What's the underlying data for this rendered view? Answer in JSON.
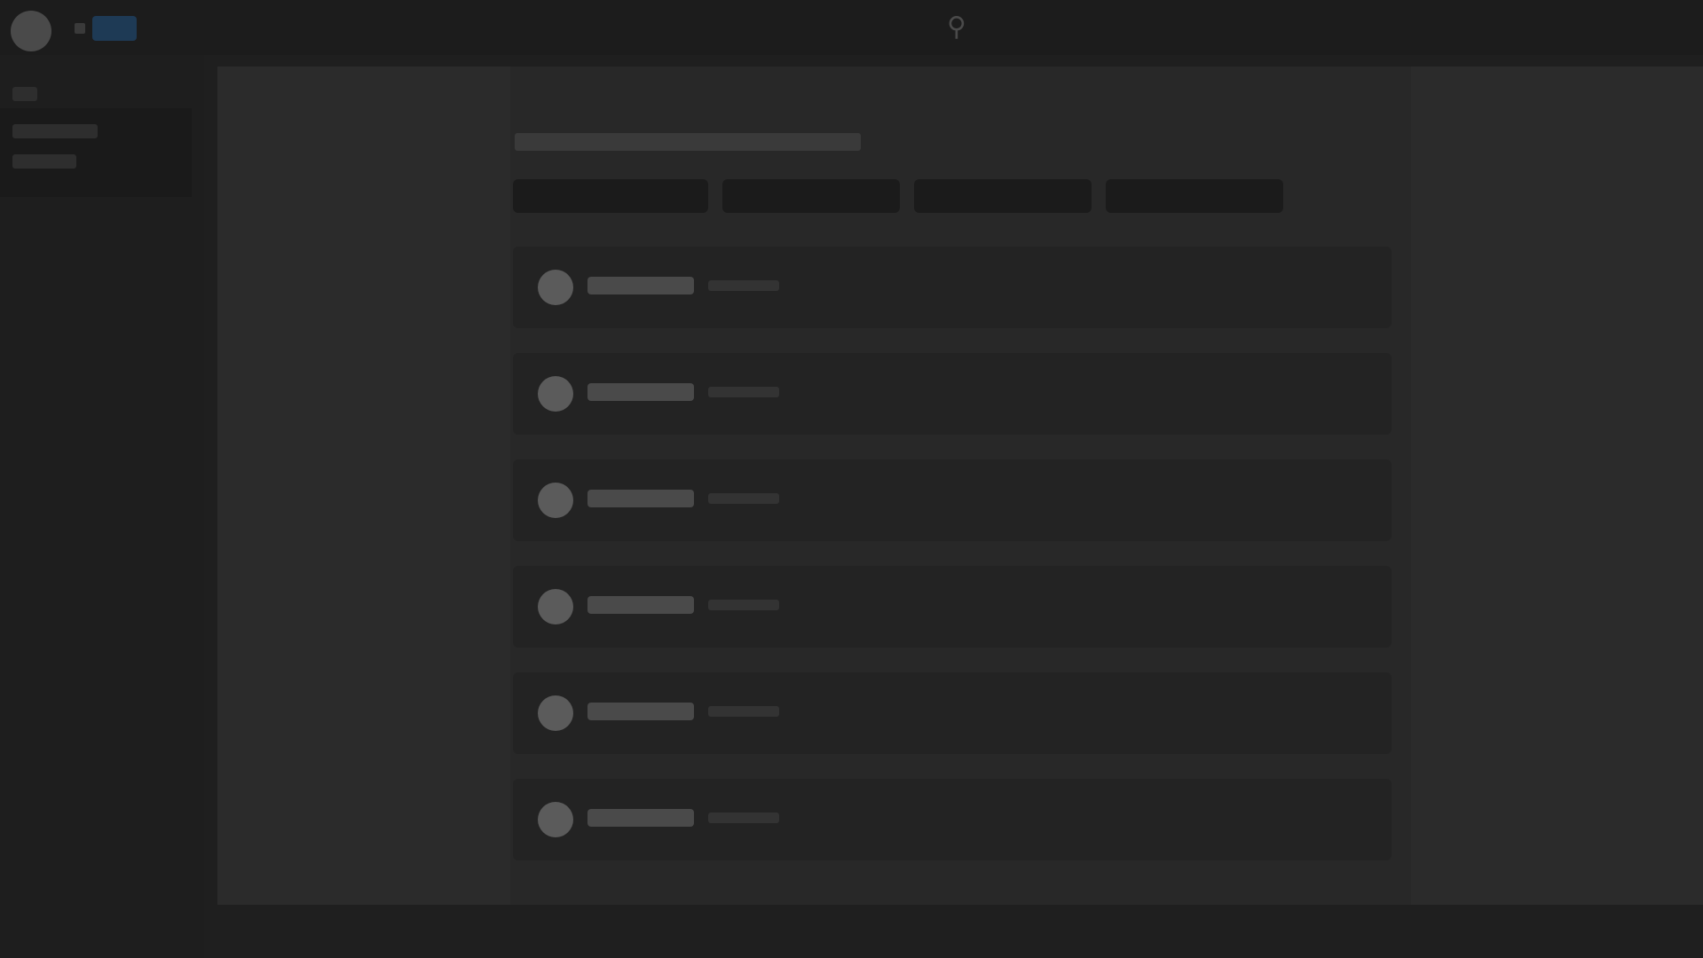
{
  "topbar": {
    "logo_icon": "app-logo-icon",
    "search_icon": "search-icon",
    "accent_color": "#1e3a55"
  },
  "sidebar": {
    "items": [
      {
        "label": ""
      },
      {
        "label": ""
      },
      {
        "label": ""
      }
    ]
  },
  "main": {
    "title": "",
    "subtitle": "",
    "tabs": [
      {
        "label": ""
      },
      {
        "label": ""
      },
      {
        "label": ""
      },
      {
        "label": ""
      }
    ],
    "list": [
      {
        "name": "",
        "meta": ""
      },
      {
        "name": "",
        "meta": ""
      },
      {
        "name": "",
        "meta": ""
      },
      {
        "name": "",
        "meta": ""
      },
      {
        "name": "",
        "meta": ""
      },
      {
        "name": "",
        "meta": ""
      }
    ]
  }
}
